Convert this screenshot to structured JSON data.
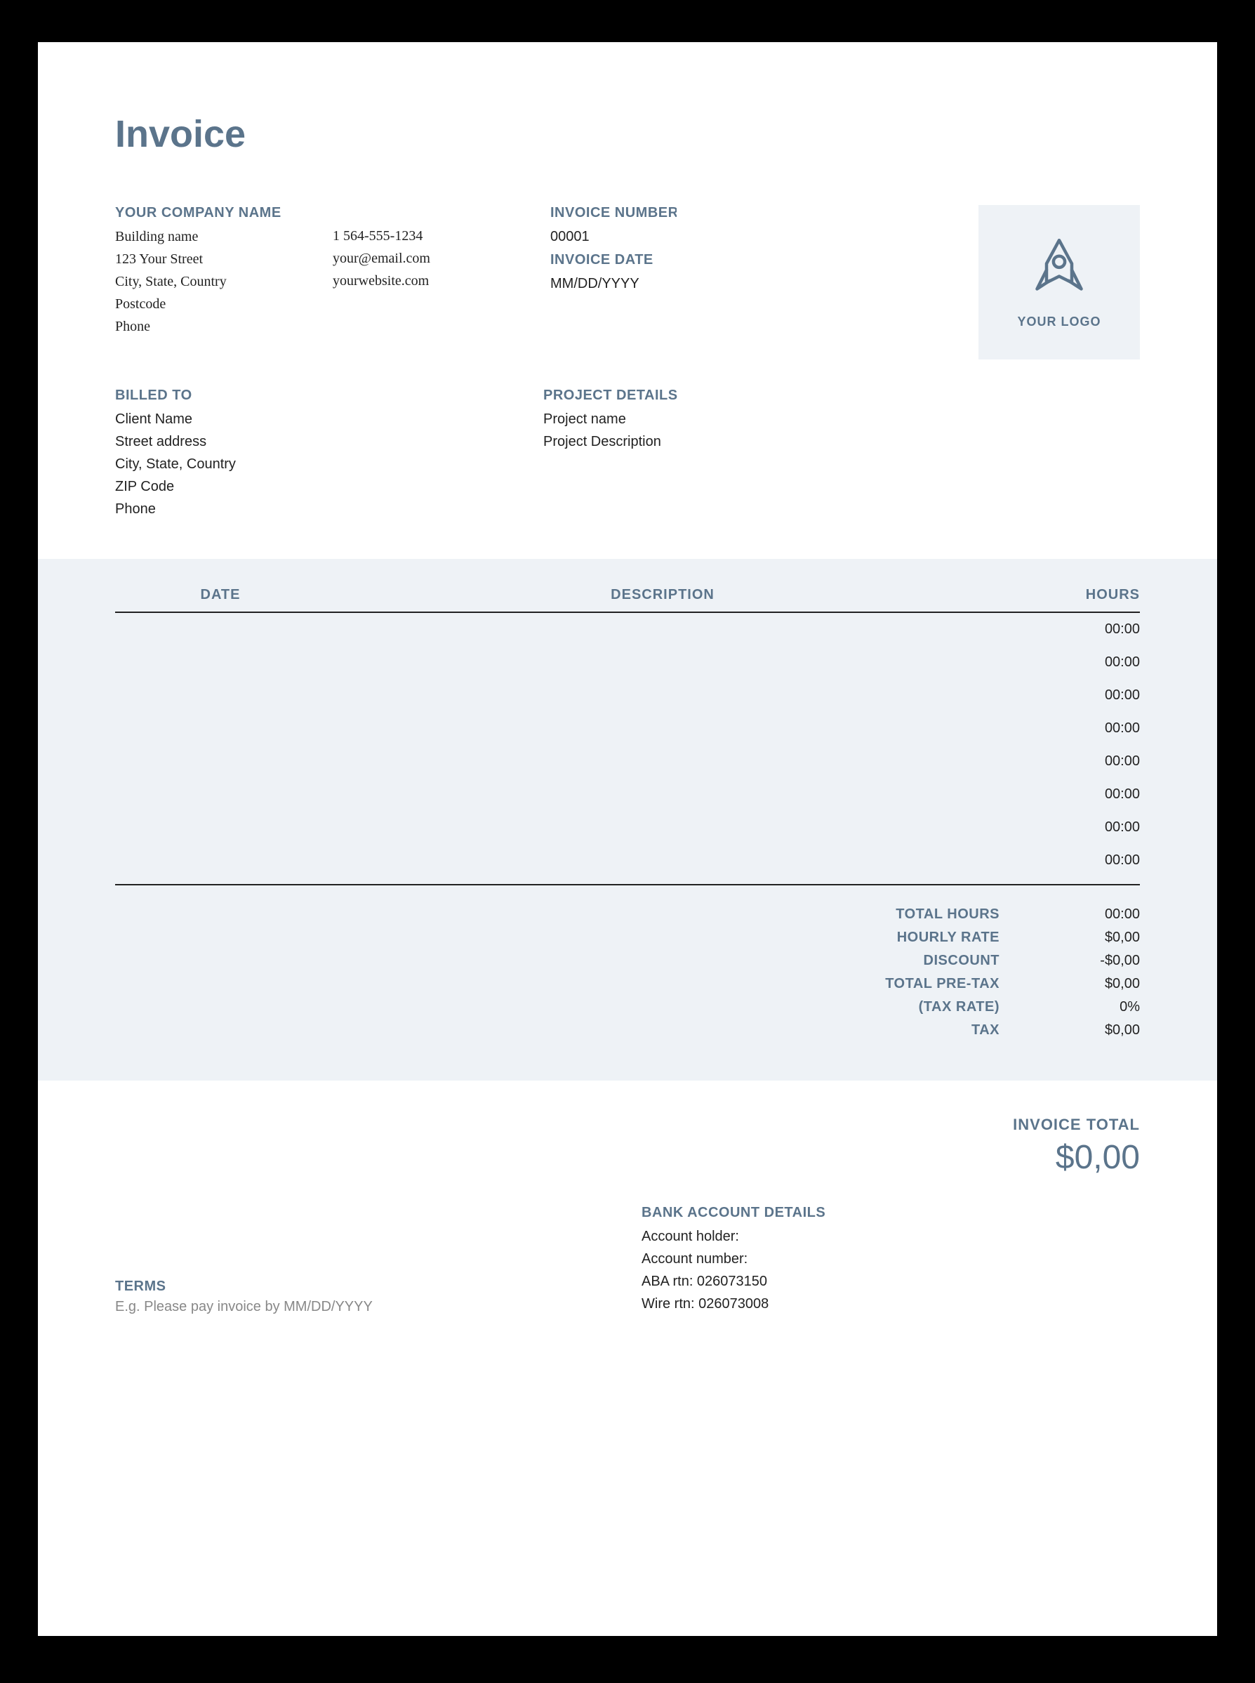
{
  "title": "Invoice",
  "company": {
    "heading": "YOUR COMPANY NAME",
    "building": "Building name",
    "street": "123 Your Street",
    "city": "City, State, Country",
    "postcode": "Postcode",
    "phone_label": "Phone",
    "phone": "1 564-555-1234",
    "email": "your@email.com",
    "website": "yourwebsite.com"
  },
  "invoice_meta": {
    "number_label": "INVOICE NUMBER",
    "number": "00001",
    "date_label": "INVOICE DATE",
    "date": "MM/DD/YYYY"
  },
  "logo": {
    "text": "YOUR LOGO"
  },
  "billed_to": {
    "heading": "BILLED TO",
    "name": "Client Name",
    "street": "Street address",
    "city": "City, State, Country",
    "zip": "ZIP Code",
    "phone": "Phone"
  },
  "project": {
    "heading": "PROJECT DETAILS",
    "name": "Project name",
    "description": "Project Description"
  },
  "table": {
    "headers": {
      "date": "DATE",
      "description": "DESCRIPTION",
      "hours": "HOURS"
    },
    "rows": [
      {
        "date": "",
        "description": "",
        "hours": "00:00"
      },
      {
        "date": "",
        "description": "",
        "hours": "00:00"
      },
      {
        "date": "",
        "description": "",
        "hours": "00:00"
      },
      {
        "date": "",
        "description": "",
        "hours": "00:00"
      },
      {
        "date": "",
        "description": "",
        "hours": "00:00"
      },
      {
        "date": "",
        "description": "",
        "hours": "00:00"
      },
      {
        "date": "",
        "description": "",
        "hours": "00:00"
      },
      {
        "date": "",
        "description": "",
        "hours": "00:00"
      }
    ]
  },
  "totals": {
    "total_hours_label": "TOTAL HOURS",
    "total_hours": "00:00",
    "hourly_rate_label": "HOURLY RATE",
    "hourly_rate": "$0,00",
    "discount_label": "DISCOUNT",
    "discount": "-$0,00",
    "pretax_label": "TOTAL PRE-TAX",
    "pretax": "$0,00",
    "taxrate_label": "(TAX RATE)",
    "taxrate": "0%",
    "tax_label": "TAX",
    "tax": "$0,00"
  },
  "invoice_total": {
    "label": "INVOICE TOTAL",
    "value": "$0,00"
  },
  "terms": {
    "heading": "TERMS",
    "text": "E.g. Please pay invoice by MM/DD/YYYY"
  },
  "bank": {
    "heading": "BANK ACCOUNT DETAILS",
    "holder": "Account holder:",
    "number": "Account number:",
    "aba": "ABA rtn: 026073150",
    "wire": "Wire rtn: 026073008"
  }
}
